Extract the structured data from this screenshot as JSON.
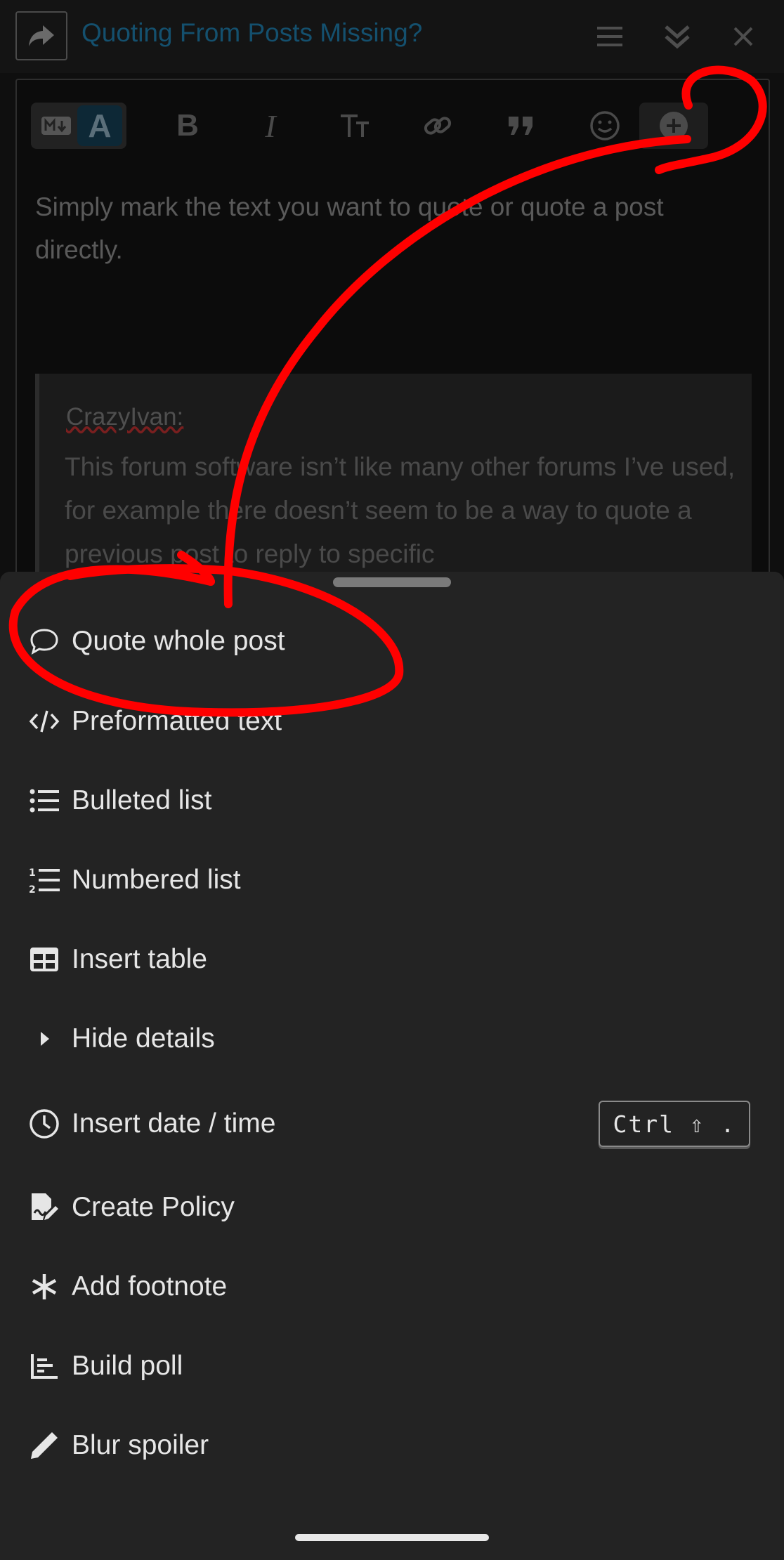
{
  "composer": {
    "topic_title": "Quoting From Posts Missing?",
    "toolbar": {
      "markdown_mode_icon": "markdown-icon",
      "rich_text_mode_label": "A"
    },
    "body_text": "Simply mark the text you want to quote or quote a post directly.",
    "quote": {
      "author": "CrazyIvan:",
      "body": "This forum software isn’t like many other forums I’ve used, for example there doesn’t seem to be a way to quote a previous post to reply to specific"
    }
  },
  "menu": {
    "items": [
      {
        "icon": "speech-bubble-icon",
        "label": "Quote whole post"
      },
      {
        "icon": "code-icon",
        "label": "Preformatted text"
      },
      {
        "icon": "bulleted-list-icon",
        "label": "Bulleted list"
      },
      {
        "icon": "numbered-list-icon",
        "label": "Numbered list"
      },
      {
        "icon": "table-icon",
        "label": "Insert table"
      },
      {
        "icon": "caret-right-icon",
        "label": "Hide details"
      },
      {
        "icon": "clock-icon",
        "label": "Insert date / time",
        "shortcut": "Ctrl ⇧ ."
      },
      {
        "icon": "signed-document-icon",
        "label": "Create Policy"
      },
      {
        "icon": "asterisk-icon",
        "label": "Add footnote"
      },
      {
        "icon": "bar-chart-icon",
        "label": "Build poll"
      },
      {
        "icon": "pencil-icon",
        "label": "Blur spoiler"
      }
    ]
  },
  "colors": {
    "annotation_red": "#ff0000",
    "sheet_background": "#232323",
    "menu_text": "#e6e6e6"
  }
}
